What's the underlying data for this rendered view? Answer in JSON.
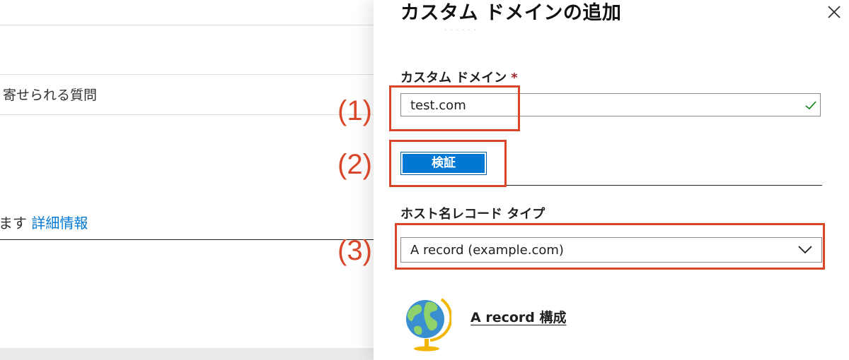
{
  "background": {
    "faq_text": "寄せられる質問",
    "info_prefix": "ます",
    "info_link": "詳細情報"
  },
  "panel": {
    "title": "カスタム ドメインの追加",
    "close_icon": "close-icon",
    "custom_domain": {
      "label": "カスタム ドメイン",
      "required_mark": "*",
      "value": "test.com",
      "valid_icon": "checkmark-icon"
    },
    "verify_button": "検証",
    "hostname_record_type": {
      "label": "ホスト名レコード タイプ",
      "selected": "A record (example.com)",
      "dropdown_icon": "chevron-down-icon"
    },
    "config_section": {
      "icon": "globe-icon",
      "link": "A record 構成"
    }
  },
  "annotations": {
    "step1": "(1)",
    "step2": "(2)",
    "step3": "(3)",
    "color": "#d9472b"
  },
  "colors": {
    "accent": "#0078d4",
    "required": "#a4262c",
    "valid": "#107c10"
  }
}
